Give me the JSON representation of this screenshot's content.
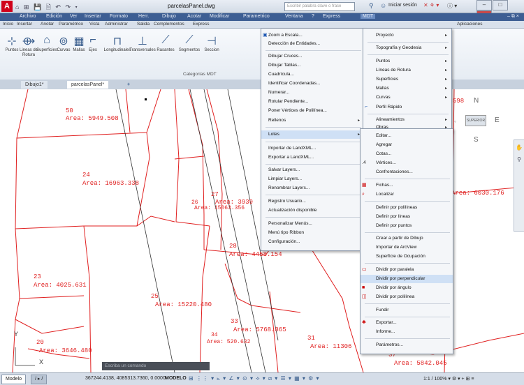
{
  "app": {
    "window_title": "parcelasPanel.dwg",
    "search_placeholder": "Escribir palabra clave o frase",
    "signin": "Iniciar sesión",
    "qat": "⌂ ⊞ 💾 🗎 ↶ ↷ ▾"
  },
  "menubar": [
    "Archivo",
    "Edición",
    "Ver",
    "Insertar",
    "Formato",
    "Herr.",
    "Dibujo",
    "Acotar",
    "Modificar",
    "Parametrico",
    "Ventana",
    "?",
    "Express",
    "MDT"
  ],
  "ribbon_tabs": [
    "Inicio",
    "Insertar",
    "Anotar",
    "Paramétrico",
    "Vista",
    "Administrar",
    "Salida",
    "Complementos",
    "Express",
    "Aplicaciones"
  ],
  "ribbon_buttons": [
    {
      "label": "Puntos",
      "icon": "points-icon"
    },
    {
      "label": "Lineas de Rotura",
      "icon": "breaklines-icon"
    },
    {
      "label": "Superficies",
      "icon": "surfaces-icon"
    },
    {
      "label": "Curvas",
      "icon": "curves-icon"
    },
    {
      "label": "Mallas",
      "icon": "mesh-icon"
    },
    {
      "label": "Ejes",
      "icon": "axes-icon"
    },
    {
      "label": "Longitudinales",
      "icon": "longitudinal-icon"
    },
    {
      "label": "Transversales",
      "icon": "cross-section-icon"
    },
    {
      "label": "Rasantes",
      "icon": "grade-icon"
    },
    {
      "label": "Segmentos",
      "icon": "segments-icon"
    },
    {
      "label": "Seccion",
      "icon": "section-icon"
    }
  ],
  "ribbon_group_label": "Categorías MDT",
  "doc_tabs": [
    "Dibujo1*",
    "parcelasPanel*"
  ],
  "drawing": {
    "parcels": [
      {
        "num": "50",
        "area": "Area: 5949.508"
      },
      {
        "num": "24",
        "area": "Area: 16963.338"
      },
      {
        "num": "27",
        "area": "Area: 3939"
      },
      {
        "num": "26",
        "area": "Area: 15063.356"
      },
      {
        "num": "28",
        "area": "Area: 4458.154"
      },
      {
        "num": "23",
        "area": "Area: 4025.631"
      },
      {
        "num": "25",
        "area": "Area: 15220.480"
      },
      {
        "num": "33",
        "area": "Area: 5768.865"
      },
      {
        "num": "34",
        "area": "Area: 520.632"
      },
      {
        "num": "31",
        "area": "Area: 11306"
      },
      {
        "num": "20",
        "area": "Area: 3646.480"
      },
      {
        "num": "37",
        "area": "Area: 5842.045"
      },
      {
        "num": "",
        "area": "Area: 6030.176"
      },
      {
        "num": "598",
        "area": ""
      }
    ]
  },
  "viewcube": {
    "north": "N",
    "south": "S",
    "east": "E",
    "top": "SUPERIOR"
  },
  "menu_main": [
    {
      "label": "Zoom a Escala...",
      "arrow": false
    },
    {
      "label": "Detección de Entidades...",
      "arrow": false
    },
    {
      "label": "Dibujar Cruces...",
      "arrow": false
    },
    {
      "label": "Dibujar Tablas...",
      "arrow": false
    },
    {
      "label": "Cuadrícula...",
      "arrow": false
    },
    {
      "label": "Identificar Coordenadas...",
      "arrow": false
    },
    {
      "label": "Numerar...",
      "arrow": false
    },
    {
      "label": "Rotular Pendiente...",
      "arrow": false
    },
    {
      "label": "Poner Vértices de Polilínea...",
      "arrow": false
    },
    {
      "label": "Rellenos",
      "arrow": true
    },
    {
      "label": "Lotes",
      "arrow": true
    },
    {
      "label": "Importar de LandXML...",
      "arrow": false
    },
    {
      "label": "Exportar a LandXML...",
      "arrow": false
    },
    {
      "label": "Salvar Layers...",
      "arrow": false
    },
    {
      "label": "Limpiar Layers...",
      "arrow": false
    },
    {
      "label": "Renombrar Layers...",
      "arrow": false
    },
    {
      "label": "Registro Usuario...",
      "arrow": false
    },
    {
      "label": "Actualización disponible",
      "arrow": false
    },
    {
      "label": "Personalizar Menús...",
      "arrow": false
    },
    {
      "label": "Menú tipo Ribbon",
      "arrow": false
    },
    {
      "label": "Configuración...",
      "arrow": false
    }
  ],
  "menu_categories": [
    {
      "label": "Proyecto",
      "arrow": true
    },
    {
      "label": "Topografía y Geodesia",
      "arrow": true
    },
    {
      "label": "Puntos",
      "arrow": true
    },
    {
      "label": "Líneas de Rotura",
      "arrow": true
    },
    {
      "label": "Superficies",
      "arrow": true
    },
    {
      "label": "Mallas",
      "arrow": true
    },
    {
      "label": "Curvas",
      "arrow": true
    },
    {
      "label": "Perfil Rápido",
      "arrow": false
    },
    {
      "label": "Alineamientos",
      "arrow": true
    },
    {
      "label": "Obras",
      "arrow": true
    }
  ],
  "menu_lotes": [
    {
      "label": "Editar...",
      "icon": ""
    },
    {
      "label": "Agregar",
      "icon": ""
    },
    {
      "label": "Cotas...",
      "icon": ""
    },
    {
      "label": "Vértices...",
      "icon": ".4"
    },
    {
      "label": "Confrontaciones...",
      "icon": ""
    },
    {
      "label": "Fichas...",
      "icon": "▦"
    },
    {
      "label": "Localizar",
      "icon": "⌕"
    },
    {
      "label": "Definir por polilíneas",
      "icon": ""
    },
    {
      "label": "Definir por líneas",
      "icon": ""
    },
    {
      "label": "Definir por puntos",
      "icon": ""
    },
    {
      "label": "Crear a partir de Dibujo",
      "icon": ""
    },
    {
      "label": "Importar de ArcView",
      "icon": ""
    },
    {
      "label": "Superficie de Ocupación",
      "icon": ""
    },
    {
      "label": "Dividir por paralela",
      "icon": "▭"
    },
    {
      "label": "Dividir por perpendicular",
      "icon": ""
    },
    {
      "label": "Dividir por ángulo",
      "icon": "■"
    },
    {
      "label": "Dividir por polilínea",
      "icon": "◫"
    },
    {
      "label": "Fundir",
      "icon": ""
    },
    {
      "label": "Exportar...",
      "icon": "✱"
    },
    {
      "label": "Informe...",
      "icon": ""
    },
    {
      "label": "Parámetros...",
      "icon": ""
    }
  ],
  "cmdline": "Escriba un comando",
  "status": {
    "model_tab": "Modelo",
    "layout_tab": "/ ▸ /",
    "coords": "367244.4138, 4085313.7360, 0.0000",
    "model_button": "MODELO",
    "tools": "⊞ ⋮⋮ ▾ ⦜ ▾ ∠ ▾ ⊙ ▾ ⟡ ▾ ⧄ ▾ ☰ ▾ ▦ ▾ ⚙ ▾",
    "scale": "1:1 / 100% ▾  ⚙ ▾  +  ⊞  ≡"
  },
  "colors": {
    "plot": "#e02020",
    "menubar": "#3d5e93",
    "logo": "#d0021b"
  }
}
